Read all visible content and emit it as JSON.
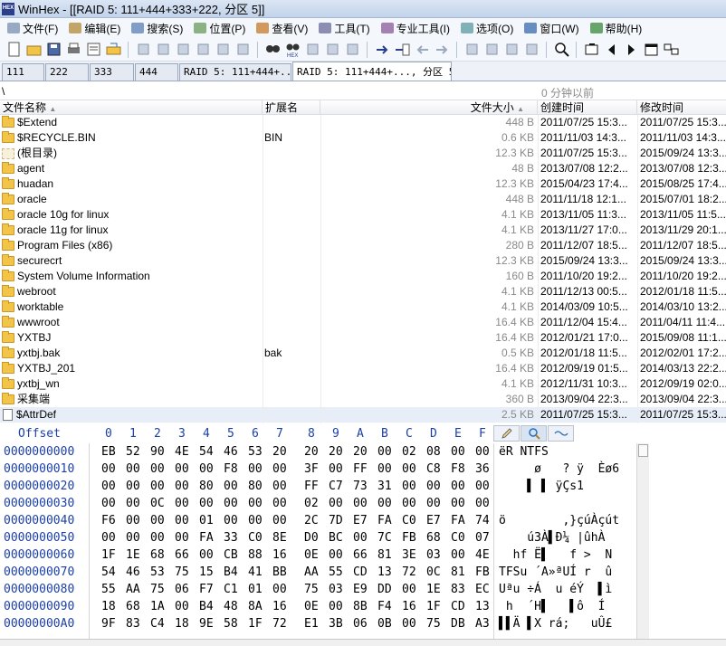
{
  "window": {
    "title": "WinHex - [[RAID 5: 111+444+333+222, 分区 5]]",
    "icon_label": "HEX"
  },
  "menu": [
    {
      "label": "文件(F)",
      "icon": "file-menu-icon"
    },
    {
      "label": "编辑(E)",
      "icon": "edit-menu-icon"
    },
    {
      "label": "搜索(S)",
      "icon": "search-menu-icon"
    },
    {
      "label": "位置(P)",
      "icon": "position-menu-icon"
    },
    {
      "label": "查看(V)",
      "icon": "view-menu-icon"
    },
    {
      "label": "工具(T)",
      "icon": "tools-menu-icon"
    },
    {
      "label": "专业工具(I)",
      "icon": "specialist-menu-icon"
    },
    {
      "label": "选项(O)",
      "icon": "options-menu-icon"
    },
    {
      "label": "窗口(W)",
      "icon": "window-menu-icon"
    },
    {
      "label": "帮助(H)",
      "icon": "help-menu-icon"
    }
  ],
  "toolbar": {
    "buttons": [
      "new-file",
      "open-file",
      "save-file",
      "print",
      "properties",
      "open-disk",
      "undo",
      "copy",
      "paste-special",
      "paste",
      "write",
      "binary",
      "find",
      "find-hex",
      "replace-text",
      "replace-hex",
      "find-again",
      "goto-offset",
      "goto-sector",
      "back",
      "forward",
      "disk-editor",
      "ram-editor",
      "calculator",
      "position-manager",
      "zoom",
      "new-window",
      "prev-window",
      "next-window",
      "maximize",
      "gallery"
    ]
  },
  "tabs": [
    {
      "label": "111",
      "active": false
    },
    {
      "label": "222",
      "active": false
    },
    {
      "label": "333",
      "active": false
    },
    {
      "label": "444",
      "active": false
    },
    {
      "label": "RAID 5: 111+444+...",
      "active": false
    },
    {
      "label": "RAID 5: 111+444+..., 分区 5",
      "active": true
    }
  ],
  "path": {
    "current": "\\",
    "elapsed": "0 分钟以前"
  },
  "filelist": {
    "headers": {
      "name": "文件名称",
      "ext": "扩展名",
      "size": "文件大小",
      "ctime": "创建时间",
      "mtime": "修改时间"
    },
    "rows": [
      {
        "icon": "folder",
        "name": "$Extend",
        "ext": "",
        "size": "448 B",
        "ctime": "2011/07/25  15:3...",
        "mtime": "2011/07/25  15:3..."
      },
      {
        "icon": "folder",
        "name": "$RECYCLE.BIN",
        "ext": "BIN",
        "size": "0.6 KB",
        "ctime": "2011/11/03  14:3...",
        "mtime": "2011/11/03  14:3..."
      },
      {
        "icon": "root",
        "name": "(根目录)",
        "ext": "",
        "size": "12.3 KB",
        "ctime": "2011/07/25  15:3...",
        "mtime": "2015/09/24  13:3..."
      },
      {
        "icon": "folder",
        "name": "agent",
        "ext": "",
        "size": "48 B",
        "ctime": "2013/07/08  12:2...",
        "mtime": "2013/07/08  12:3..."
      },
      {
        "icon": "folder",
        "name": "huadan",
        "ext": "",
        "size": "12.3 KB",
        "ctime": "2015/04/23  17:4...",
        "mtime": "2015/08/25  17:4..."
      },
      {
        "icon": "folder",
        "name": "oracle",
        "ext": "",
        "size": "448 B",
        "ctime": "2011/11/18  12:1...",
        "mtime": "2015/07/01  18:2..."
      },
      {
        "icon": "folder",
        "name": "oracle 10g for linux",
        "ext": "",
        "size": "4.1 KB",
        "ctime": "2013/11/05  11:3...",
        "mtime": "2013/11/05  11:5..."
      },
      {
        "icon": "folder",
        "name": "oracle 11g for linux",
        "ext": "",
        "size": "4.1 KB",
        "ctime": "2013/11/27  17:0...",
        "mtime": "2013/11/29  20:1..."
      },
      {
        "icon": "folder",
        "name": "Program Files (x86)",
        "ext": "",
        "size": "280 B",
        "ctime": "2011/12/07  18:5...",
        "mtime": "2011/12/07  18:5..."
      },
      {
        "icon": "folder",
        "name": "securecrt",
        "ext": "",
        "size": "12.3 KB",
        "ctime": "2015/09/24  13:3...",
        "mtime": "2015/09/24  13:3..."
      },
      {
        "icon": "folder",
        "name": "System Volume Information",
        "ext": "",
        "size": "160 B",
        "ctime": "2011/10/20  19:2...",
        "mtime": "2011/10/20  19:2..."
      },
      {
        "icon": "folder",
        "name": "webroot",
        "ext": "",
        "size": "4.1 KB",
        "ctime": "2011/12/13  00:5...",
        "mtime": "2012/01/18  11:5..."
      },
      {
        "icon": "folder",
        "name": "worktable",
        "ext": "",
        "size": "4.1 KB",
        "ctime": "2014/03/09  10:5...",
        "mtime": "2014/03/10  13:2..."
      },
      {
        "icon": "folder",
        "name": "wwwroot",
        "ext": "",
        "size": "16.4 KB",
        "ctime": "2011/12/04  15:4...",
        "mtime": "2011/04/11  11:4..."
      },
      {
        "icon": "folder",
        "name": "YXTBJ",
        "ext": "",
        "size": "16.4 KB",
        "ctime": "2012/01/21  17:0...",
        "mtime": "2015/09/08  11:1..."
      },
      {
        "icon": "folder",
        "name": "yxtbj.bak",
        "ext": "bak",
        "size": "0.5 KB",
        "ctime": "2012/01/18  11:5...",
        "mtime": "2012/02/01  17:2..."
      },
      {
        "icon": "folder",
        "name": "YXTBJ_201",
        "ext": "",
        "size": "16.4 KB",
        "ctime": "2012/09/19  01:5...",
        "mtime": "2014/03/13  22:2..."
      },
      {
        "icon": "folder",
        "name": "yxtbj_wn",
        "ext": "",
        "size": "4.1 KB",
        "ctime": "2012/11/31  10:3...",
        "mtime": "2012/09/19  02:0..."
      },
      {
        "icon": "folder",
        "name": "采集端",
        "ext": "",
        "size": "360 B",
        "ctime": "2013/09/04  22:3...",
        "mtime": "2013/09/04  22:3..."
      },
      {
        "icon": "file",
        "name": "$AttrDef",
        "ext": "",
        "size": "2.5 KB",
        "ctime": "2011/07/25  15:3...",
        "mtime": "2011/07/25  15:3..."
      }
    ]
  },
  "hex": {
    "offset_label": "Offset",
    "columns": [
      "0",
      "1",
      "2",
      "3",
      "4",
      "5",
      "6",
      "7",
      "8",
      "9",
      "A",
      "B",
      "C",
      "D",
      "E",
      "F"
    ],
    "rows": [
      {
        "offset": "0000000000",
        "bytes": [
          "EB",
          "52",
          "90",
          "4E",
          "54",
          "46",
          "53",
          "20",
          "20",
          "20",
          "20",
          "00",
          "02",
          "08",
          "00",
          "00"
        ],
        "ascii": "ëR NTFS"
      },
      {
        "offset": "0000000010",
        "bytes": [
          "00",
          "00",
          "00",
          "00",
          "00",
          "F8",
          "00",
          "00",
          "3F",
          "00",
          "FF",
          "00",
          "00",
          "C8",
          "F8",
          "36"
        ],
        "ascii": "     ø   ? ÿ  Èø6"
      },
      {
        "offset": "0000000020",
        "bytes": [
          "00",
          "00",
          "00",
          "00",
          "80",
          "00",
          "80",
          "00",
          "FF",
          "C7",
          "73",
          "31",
          "00",
          "00",
          "00",
          "00"
        ],
        "ascii": "    ▌ ▌ ÿÇs1"
      },
      {
        "offset": "0000000030",
        "bytes": [
          "00",
          "00",
          "0C",
          "00",
          "00",
          "00",
          "00",
          "00",
          "02",
          "00",
          "00",
          "00",
          "00",
          "00",
          "00",
          "00"
        ],
        "ascii": ""
      },
      {
        "offset": "0000000040",
        "bytes": [
          "F6",
          "00",
          "00",
          "00",
          "01",
          "00",
          "00",
          "00",
          "2C",
          "7D",
          "E7",
          "FA",
          "C0",
          "E7",
          "FA",
          "74"
        ],
        "ascii": "ö        ,}çúÀçút"
      },
      {
        "offset": "0000000050",
        "bytes": [
          "00",
          "00",
          "00",
          "00",
          "FA",
          "33",
          "C0",
          "8E",
          "D0",
          "BC",
          "00",
          "7C",
          "FB",
          "68",
          "C0",
          "07"
        ],
        "ascii": "    ú3À▌Ð¼ |ûhÀ"
      },
      {
        "offset": "0000000060",
        "bytes": [
          "1F",
          "1E",
          "68",
          "66",
          "00",
          "CB",
          "88",
          "16",
          "0E",
          "00",
          "66",
          "81",
          "3E",
          "03",
          "00",
          "4E"
        ],
        "ascii": "  hf Ë▌   f >  N"
      },
      {
        "offset": "0000000070",
        "bytes": [
          "54",
          "46",
          "53",
          "75",
          "15",
          "B4",
          "41",
          "BB",
          "AA",
          "55",
          "CD",
          "13",
          "72",
          "0C",
          "81",
          "FB"
        ],
        "ascii": "TFSu ´A»ªUÍ r  û"
      },
      {
        "offset": "0000000080",
        "bytes": [
          "55",
          "AA",
          "75",
          "06",
          "F7",
          "C1",
          "01",
          "00",
          "75",
          "03",
          "E9",
          "DD",
          "00",
          "1E",
          "83",
          "EC"
        ],
        "ascii": "Uªu ÷Á  u éÝ  ▌ì"
      },
      {
        "offset": "0000000090",
        "bytes": [
          "18",
          "68",
          "1A",
          "00",
          "B4",
          "48",
          "8A",
          "16",
          "0E",
          "00",
          "8B",
          "F4",
          "16",
          "1F",
          "CD",
          "13"
        ],
        "ascii": " h  ´H▌   ▌ô  Í"
      },
      {
        "offset": "00000000A0",
        "bytes": [
          "9F",
          "83",
          "C4",
          "18",
          "9E",
          "58",
          "1F",
          "72",
          "E1",
          "3B",
          "06",
          "0B",
          "00",
          "75",
          "DB",
          "A3"
        ],
        "ascii": "▌▌Ä ▌X rá;   uÛ£"
      }
    ]
  },
  "colors": {
    "offset_blue": "#1b3fa8",
    "folder_yellow": "#f2c447",
    "size_gray": "#8a8a8a",
    "title_bar": "#c2d3ea"
  }
}
